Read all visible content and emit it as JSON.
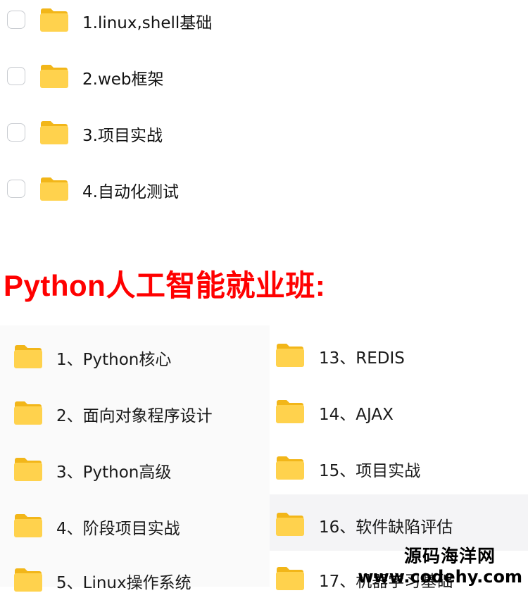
{
  "top_folders": [
    {
      "label": "1.linux,shell基础"
    },
    {
      "label": "2.web框架"
    },
    {
      "label": "3.项目实战"
    },
    {
      "label": "4.自动化测试"
    }
  ],
  "section_heading": "Python人工智能就业班:",
  "left_column": [
    {
      "label": "1、Python核心"
    },
    {
      "label": "2、面向对象程序设计"
    },
    {
      "label": "3、Python高级"
    },
    {
      "label": "4、阶段项目实战"
    },
    {
      "label": "5、Linux操作系统"
    }
  ],
  "right_column": [
    {
      "label": "13、REDIS"
    },
    {
      "label": "14、AJAX"
    },
    {
      "label": "15、项目实战"
    },
    {
      "label": "16、软件缺陷评估"
    },
    {
      "label": "17、机器学习基础"
    }
  ],
  "watermark": {
    "line1": "源码海洋网",
    "line2": "www.codehy.com"
  },
  "colors": {
    "heading": "#ff0000",
    "folder_body": "#ffd24d",
    "folder_tab": "#f2b619"
  }
}
